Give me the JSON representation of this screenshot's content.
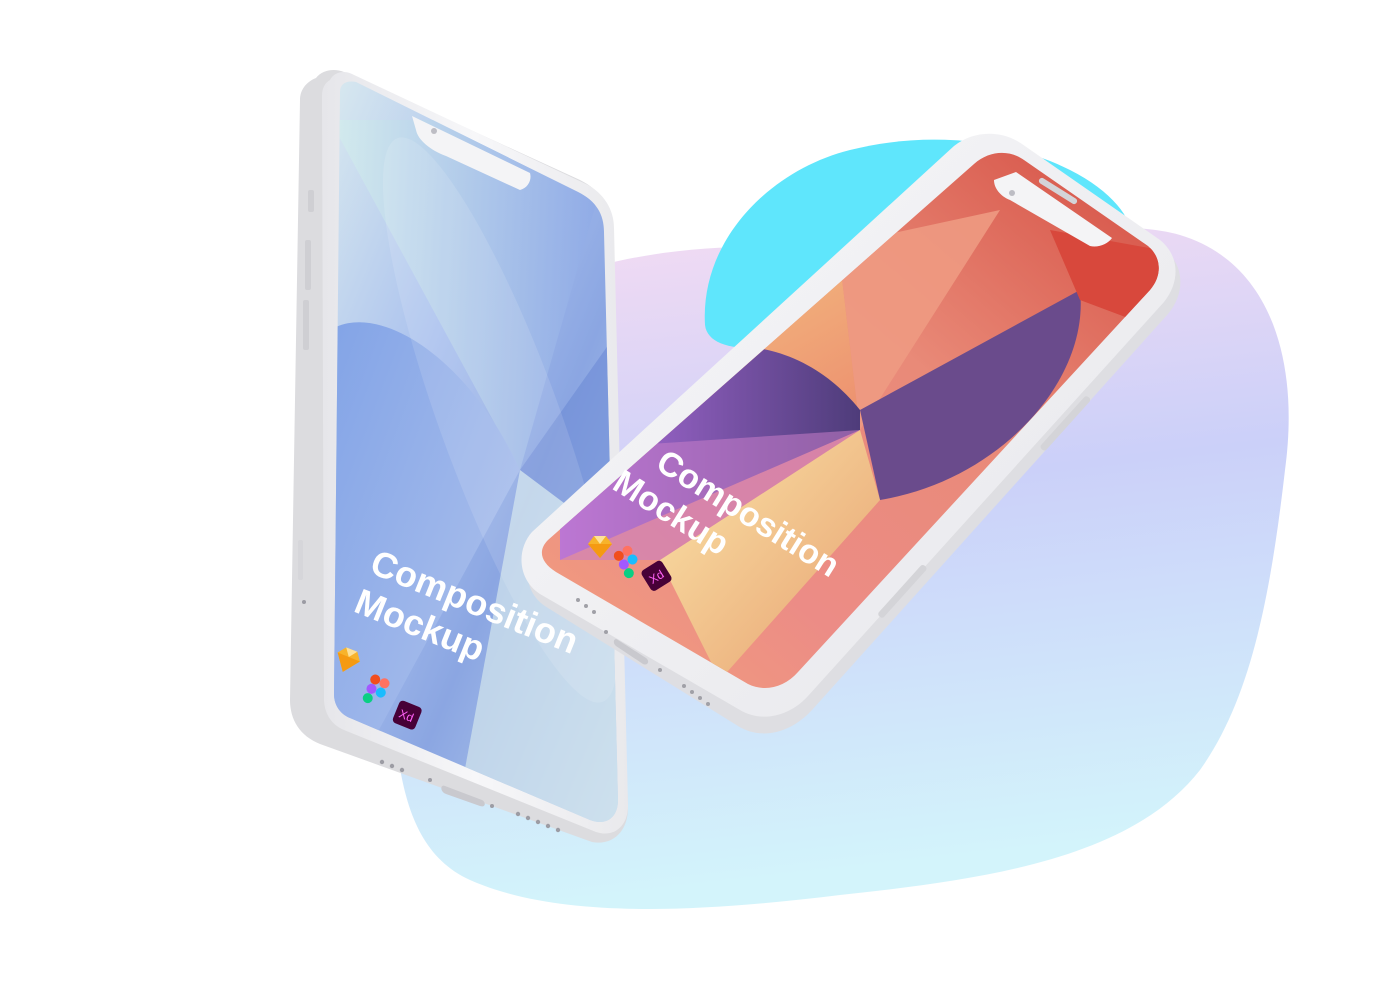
{
  "scene": {
    "colors": {
      "blob_top": "#f4d9f2",
      "blob_mid": "#c9d2fa",
      "blob_bottom": "#d2f3fb",
      "cyan_blob": "#5ee6fb",
      "phone_body": "#f4f4f6",
      "phone_edge": "#dcdcdf"
    }
  },
  "phone_left": {
    "title_line1": "Composition",
    "title_line2": "Mockup",
    "icons": [
      "sketch-icon",
      "figma-icon",
      "xd-icon"
    ],
    "xd_label": "Xd",
    "gradient": [
      "#a9c2ef",
      "#cde6ea",
      "#9fb6e8",
      "#6f8ed8"
    ]
  },
  "phone_right": {
    "title_line1": "Composition",
    "title_line2": "Mockup",
    "icons": [
      "sketch-icon",
      "figma-icon",
      "xd-icon"
    ],
    "xd_label": "Xd",
    "gradient": [
      "#f6c98f",
      "#e07b80",
      "#9f6fd9",
      "#4d3a78"
    ]
  }
}
